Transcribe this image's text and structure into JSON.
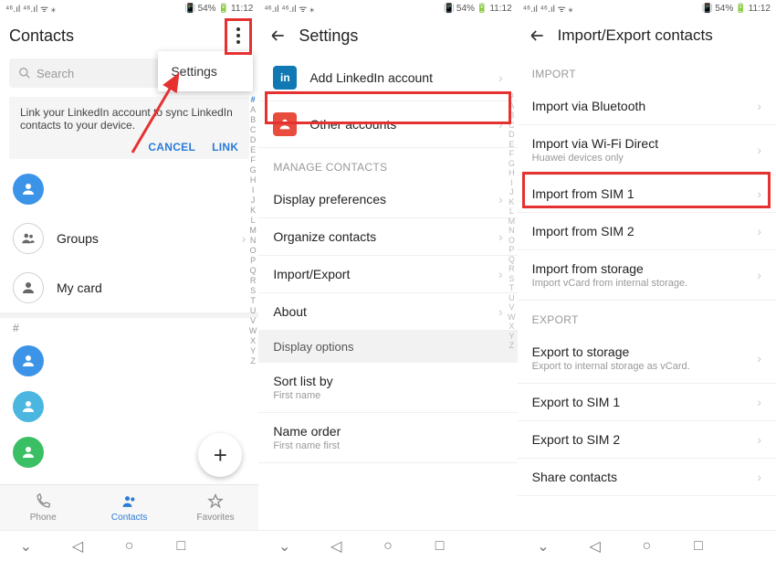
{
  "status": {
    "left": "⁴⁶.ıl ⁴⁶.ıl ᯤ ⁎",
    "percent": "54%",
    "time": "11:12"
  },
  "screen1": {
    "title": "Contacts",
    "search_placeholder": "Search",
    "linkedin_msg": "Link your LinkedIn account to sync LinkedIn contacts to your device.",
    "cancel": "CANCEL",
    "link": "LINK",
    "groups": "Groups",
    "mycard": "My card",
    "hash": "#",
    "popup_settings": "Settings",
    "tabs": {
      "phone": "Phone",
      "contacts": "Contacts",
      "favorites": "Favorites"
    },
    "alpha": [
      "#",
      "A",
      "B",
      "C",
      "D",
      "E",
      "F",
      "G",
      "H",
      "I",
      "J",
      "K",
      "L",
      "M",
      "N",
      "O",
      "P",
      "Q",
      "R",
      "S",
      "T",
      "U",
      "V",
      "W",
      "X",
      "Y",
      "Z"
    ]
  },
  "screen2": {
    "title": "Settings",
    "add_linkedin": "Add LinkedIn account",
    "other_accounts": "Other accounts",
    "manage_header": "MANAGE CONTACTS",
    "display_pref": "Display preferences",
    "organize": "Organize contacts",
    "import_export": "Import/Export",
    "about": "About",
    "display_options": "Display options",
    "sort_list": "Sort list by",
    "sort_val": "First name",
    "name_order": "Name order",
    "name_val": "First name first",
    "linkedin_icon": "in",
    "alpha": [
      "#",
      "A",
      "B",
      "C",
      "D",
      "E",
      "F",
      "G",
      "H",
      "I",
      "J",
      "K",
      "L",
      "M",
      "N",
      "O",
      "P",
      "Q",
      "R",
      "S",
      "T",
      "U",
      "V",
      "W",
      "X",
      "Y",
      "Z"
    ]
  },
  "screen3": {
    "title": "Import/Export contacts",
    "import_header": "IMPORT",
    "import_bt": "Import via Bluetooth",
    "import_wifi": "Import via Wi-Fi Direct",
    "import_wifi_sub": "Huawei devices only",
    "import_sim1": "Import from SIM 1",
    "import_sim2": "Import from SIM 2",
    "import_storage": "Import from storage",
    "import_storage_sub": "Import vCard from internal storage.",
    "export_header": "EXPORT",
    "export_storage": "Export to storage",
    "export_storage_sub": "Export to internal storage as vCard.",
    "export_sim1": "Export to SIM 1",
    "export_sim2": "Export to SIM 2",
    "share": "Share contacts"
  }
}
